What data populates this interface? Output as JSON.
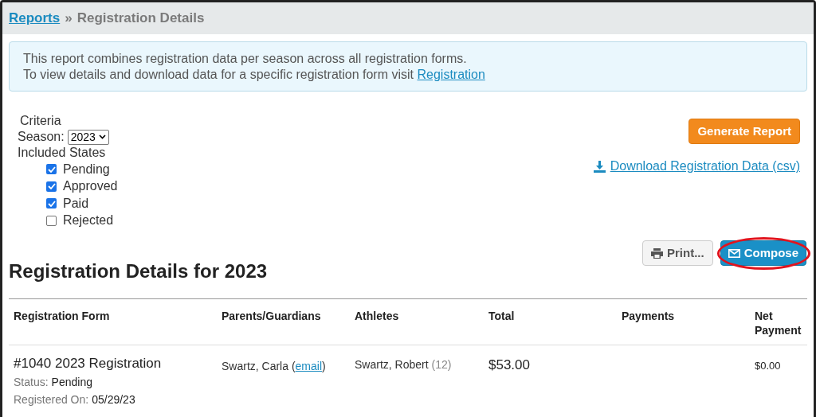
{
  "breadcrumb": {
    "link": "Reports",
    "separator": "»",
    "current": "Registration Details"
  },
  "info": {
    "line_1": "This report combines registration data per season across all registration forms.",
    "line_2": "To view details and download data for a specific registration form visit",
    "link": "Registration"
  },
  "criteria": {
    "title": "Criteria",
    "season_label": "Season:",
    "season_value": "2023",
    "states_label": "Included States",
    "states": [
      {
        "label": "Pending",
        "checked": true
      },
      {
        "label": "Approved",
        "checked": true
      },
      {
        "label": "Paid",
        "checked": true
      },
      {
        "label": "Rejected",
        "checked": false
      }
    ]
  },
  "generate_button": "Generate Report",
  "download_link": "Download Registration Data (csv)",
  "print_button": "Print...",
  "compose_button": {
    "label": "Compose",
    "highlighted": true
  },
  "heading": "Registration Details for 2023",
  "table": {
    "columns": [
      "Registration Form",
      "Parents/Guardians",
      "Athletes",
      "Total",
      "Payments",
      "Net Payment"
    ],
    "rows": [
      {
        "form": "#1040 2023 Registration",
        "status_label": "Status:",
        "status": "Pending",
        "registered_label": "Registered On:",
        "registered": "05/29/23",
        "guardian_before": "Swartz, Carla (",
        "guardian_email": "email",
        "guardian_after": ")",
        "athlete": "Swartz, Robert",
        "athlete_age": "(12)",
        "total": "$53.00",
        "net_payment": "$0.00"
      }
    ]
  }
}
